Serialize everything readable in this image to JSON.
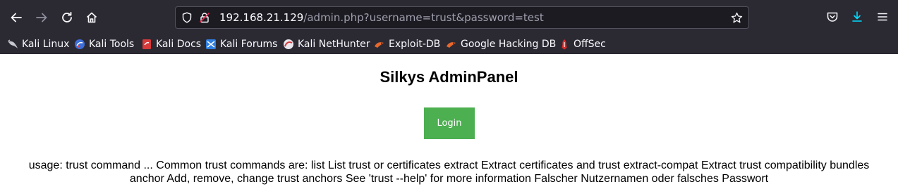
{
  "browser": {
    "url_host": "192.168.21.129",
    "url_path": "/admin.php?username=trust&password=test",
    "bookmarks": [
      {
        "label": "Kali Linux",
        "icon": "kali-dragon-icon"
      },
      {
        "label": "Kali Tools",
        "icon": "kali-tools-icon"
      },
      {
        "label": "Kali Docs",
        "icon": "kali-docs-icon"
      },
      {
        "label": "Kali Forums",
        "icon": "kali-forums-icon"
      },
      {
        "label": "Kali NetHunter",
        "icon": "kali-nethunter-icon"
      },
      {
        "label": "Exploit-DB",
        "icon": "exploit-db-icon"
      },
      {
        "label": "Google Hacking DB",
        "icon": "ghdb-icon"
      },
      {
        "label": "OffSec",
        "icon": "offsec-icon"
      }
    ],
    "colors": {
      "chrome_bg": "#2b2a33",
      "urlbar_bg": "#1c1b22",
      "download_accent": "#0df"
    }
  },
  "page": {
    "title": "Silkys AdminPanel",
    "login_button": "Login",
    "output_text": "usage: trust command ... Common trust commands are: list List trust or certificates extract Extract certificates and trust extract-compat Extract trust compatibility bundles anchor Add, remove, change trust anchors See 'trust --help' for more information Falscher Nutzernamen oder falsches Passwort",
    "colors": {
      "login_button_bg": "#4caf50"
    }
  }
}
